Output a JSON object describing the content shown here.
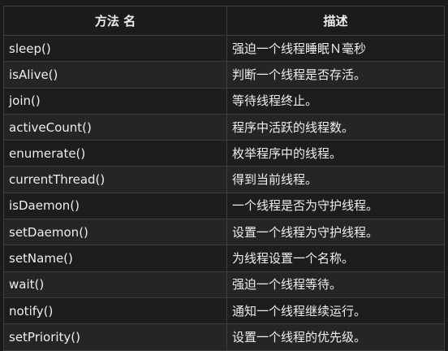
{
  "table": {
    "headers": [
      "方法 名",
      "描述"
    ],
    "rows": [
      [
        "sleep()",
        "强迫一个线程睡眠Ｎ毫秒"
      ],
      [
        "isAlive()",
        "判断一个线程是否存活。"
      ],
      [
        "join()",
        "等待线程终止。"
      ],
      [
        "activeCount()",
        "程序中活跃的线程数。"
      ],
      [
        "enumerate()",
        "枚举程序中的线程。"
      ],
      [
        "currentThread()",
        "得到当前线程。"
      ],
      [
        "isDaemon()",
        "一个线程是否为守护线程。"
      ],
      [
        "setDaemon()",
        "设置一个线程为守护线程。"
      ],
      [
        "setName()",
        "为线程设置一个名称。"
      ],
      [
        "wait()",
        "强迫一个线程等待。"
      ],
      [
        "notify()",
        "通知一个线程继续运行。"
      ],
      [
        "setPriority()",
        "设置一个线程的优先级。"
      ]
    ]
  }
}
